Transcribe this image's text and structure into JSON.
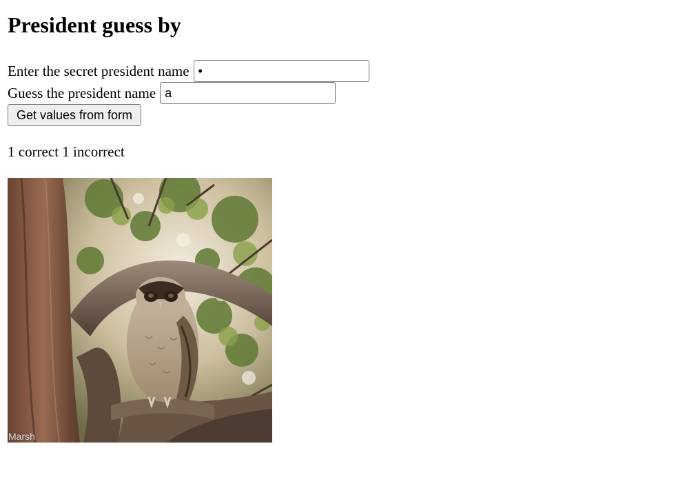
{
  "page": {
    "title": "President guess by"
  },
  "form": {
    "secret_label": "Enter the secret president name",
    "secret_value": "a",
    "guess_label": "Guess the president name",
    "guess_value": "a",
    "submit_label": "Get values from form"
  },
  "result": {
    "text": "1 correct 1 incorrect"
  },
  "image": {
    "subject": "owl perched in tree",
    "watermark": "Marsh"
  },
  "colors": {
    "button_bg": "#efefef",
    "input_border": "#767676"
  }
}
